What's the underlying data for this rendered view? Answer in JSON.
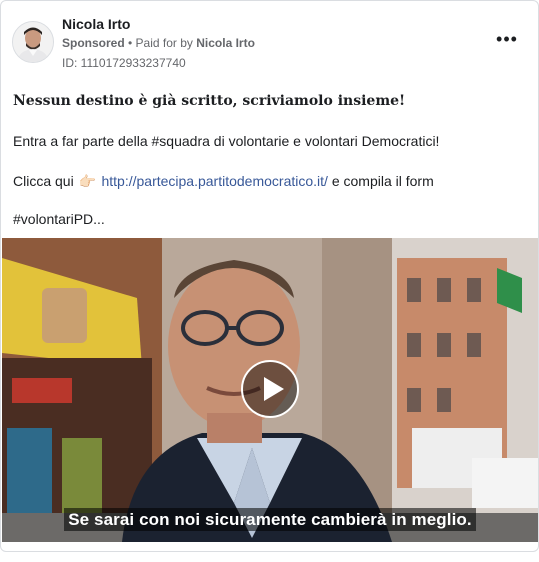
{
  "advertiser": {
    "name": "Nicola Irto",
    "sponsored_label": "Sponsored",
    "separator": " • ",
    "paid_for_prefix": "Paid for by ",
    "paid_for_name": "Nicola Irto",
    "id_text": "ID: 1110172933237740"
  },
  "more_options_icon": "more-horizontal-icon",
  "post": {
    "headline": "Nessun destino è già scritto, scriviamolo insieme!",
    "paragraph1": "Entra a far parte della #squadra di volontarie e volontari Democratici!",
    "paragraph2_prefix": "Clicca qui",
    "hand_emoji": "👉🏻",
    "link": "http://partecipa.partitodemocratico.it/",
    "paragraph2_suffix": " e compila il form",
    "hashtags": "#volontariPD..."
  },
  "video": {
    "subtitle": "Se sarai con noi sicuramente cambierà in meglio.",
    "play_icon": "play-icon"
  },
  "colors": {
    "link": "#385898",
    "text": "#1c1e21",
    "meta": "#65676b",
    "border": "#dadde1"
  }
}
